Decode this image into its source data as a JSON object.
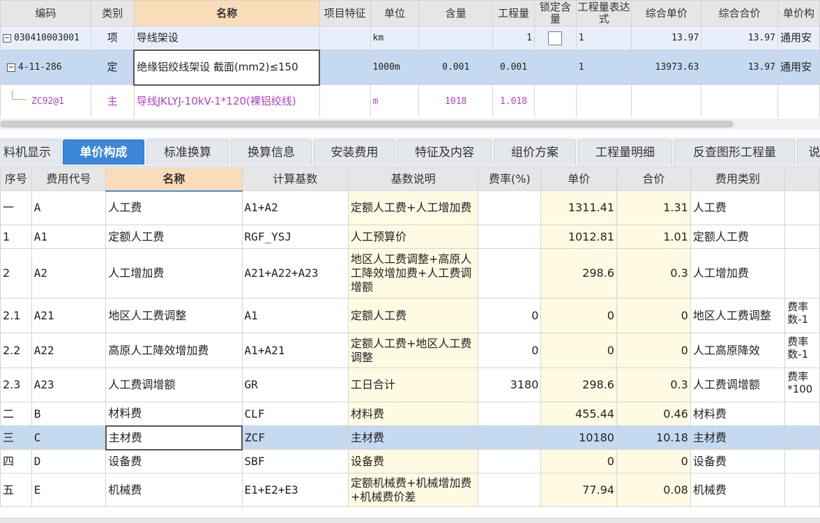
{
  "top_grid": {
    "headers": [
      "编码",
      "类别",
      "名称",
      "项目特征",
      "单位",
      "含量",
      "工程量",
      "锁定含量",
      "工程量表达式",
      "综合单价",
      "综合合价",
      "单价构"
    ],
    "rows": [
      {
        "toggle": "−",
        "code": "030410003001",
        "type": "项",
        "name": "导线架设",
        "feature": "",
        "unit": "km",
        "content": "",
        "qty": "1",
        "lock": "",
        "expr": "1",
        "unit_price": "13.97",
        "total_price": "13.97",
        "rate_type": "通用安"
      },
      {
        "toggle": "−",
        "code": "4-11-286",
        "type": "定",
        "name": "绝缘铝绞线架设 截面(mm2)≤150",
        "feature": "",
        "unit": "1000m",
        "content": "0.001",
        "qty": "0.001",
        "lock": "",
        "expr": "1",
        "unit_price": "13973.63",
        "total_price": "13.97",
        "rate_type": "通用安"
      },
      {
        "toggle": "",
        "code": "ZC92@1",
        "type": "主",
        "name": "导线JKLYJ-10kV-1*120(裸铝绞线)",
        "feature": "",
        "unit": "m",
        "content": "1018",
        "qty": "1.018",
        "lock": "",
        "expr": "",
        "unit_price": "",
        "total_price": "",
        "rate_type": ""
      }
    ]
  },
  "tabs": [
    "料机显示",
    "单价构成",
    "标准换算",
    "换算信息",
    "安装费用",
    "特征及内容",
    "组价方案",
    "工程量明细",
    "反查图形工程量",
    "说"
  ],
  "active_tab": "单价构成",
  "bottom_grid": {
    "headers": [
      "序号",
      "费用代号",
      "名称",
      "计算基数",
      "基数说明",
      "费率(%)",
      "单价",
      "合价",
      "费用类别",
      ""
    ],
    "rows": [
      {
        "seq": "一",
        "code": "A",
        "name": "人工费",
        "base": "A1+A2",
        "desc": "定额人工费+人工增加费",
        "rate": "",
        "price": "1311.41",
        "total": "1.31",
        "category": "人工费",
        "note": ""
      },
      {
        "seq": "1",
        "code": "A1",
        "name": "定额人工费",
        "base": "RGF_YSJ",
        "desc": "人工预算价",
        "rate": "",
        "price": "1012.81",
        "total": "1.01",
        "category": "定额人工费",
        "note": ""
      },
      {
        "seq": "2",
        "code": "A2",
        "name": "人工增加费",
        "base": "A21+A22+A23",
        "desc": "地区人工费调整+高原人工降效增加费+人工费调增额",
        "rate": "",
        "price": "298.6",
        "total": "0.3",
        "category": "人工增加费",
        "note": ""
      },
      {
        "seq": "2.1",
        "code": "A21",
        "name": "地区人工费调整",
        "base": "A1",
        "desc": "定额人工费",
        "rate": "0",
        "price": "0",
        "total": "0",
        "category": "地区人工费调整",
        "note": "费率数-1"
      },
      {
        "seq": "2.2",
        "code": "A22",
        "name": "高原人工降效增加费",
        "base": "A1+A21",
        "desc": "定额人工费+地区人工费调整",
        "rate": "0",
        "price": "0",
        "total": "0",
        "category": "人工高原降效",
        "note": "费率数-1"
      },
      {
        "seq": "2.3",
        "code": "A23",
        "name": "人工费调增额",
        "base": "GR",
        "desc": "工日合计",
        "rate": "3180",
        "price": "298.6",
        "total": "0.3",
        "category": "人工费调增额",
        "note": "费率*100"
      },
      {
        "seq": "二",
        "code": "B",
        "name": "材料费",
        "base": "CLF",
        "desc": "材料费",
        "rate": "",
        "price": "455.44",
        "total": "0.46",
        "category": "材料费",
        "note": ""
      },
      {
        "seq": "三",
        "code": "C",
        "name": "主材费",
        "base": "ZCF",
        "desc": "主材费",
        "rate": "",
        "price": "10180",
        "total": "10.18",
        "category": "主材费",
        "note": ""
      },
      {
        "seq": "四",
        "code": "D",
        "name": "设备费",
        "base": "SBF",
        "desc": "设备费",
        "rate": "",
        "price": "0",
        "total": "0",
        "category": "设备费",
        "note": ""
      },
      {
        "seq": "五",
        "code": "E",
        "name": "机械费",
        "base": "E1+E2+E3",
        "desc": "定额机械费+机械增加费+机械费价差",
        "rate": "",
        "price": "77.94",
        "total": "0.08",
        "category": "机械费",
        "note": ""
      }
    ]
  }
}
